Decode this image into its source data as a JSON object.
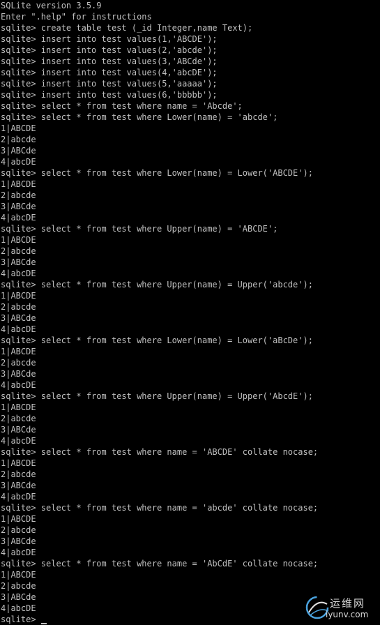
{
  "terminal": {
    "lines": [
      "SQLite version 3.5.9",
      "Enter \".help\" for instructions",
      "sqlite> create table test (_id Integer,name Text);",
      "sqlite> insert into test values(1,'ABCDE');",
      "sqlite> insert into test values(2,'abcde');",
      "sqlite> insert into test values(3,'ABCde');",
      "sqlite> insert into test values(4,'abcDE');",
      "sqlite> insert into test values(5,'aaaaa');",
      "sqlite> insert into test values(6,'bbbbb');",
      "sqlite> select * from test where name = 'Abcde';",
      "sqlite> select * from test where Lower(name) = 'abcde';",
      "1|ABCDE",
      "2|abcde",
      "3|ABCde",
      "4|abcDE",
      "sqlite> select * from test where Lower(name) = Lower('ABCDE');",
      "1|ABCDE",
      "2|abcde",
      "3|ABCde",
      "4|abcDE",
      "sqlite> select * from test where Upper(name) = 'ABCDE';",
      "1|ABCDE",
      "2|abcde",
      "3|ABCde",
      "4|abcDE",
      "sqlite> select * from test where Upper(name) = Upper('abcde');",
      "1|ABCDE",
      "2|abcde",
      "3|ABCde",
      "4|abcDE",
      "sqlite> select * from test where Lower(name) = Lower('aBcDe');",
      "1|ABCDE",
      "2|abcde",
      "3|ABCde",
      "4|abcDE",
      "sqlite> select * from test where Upper(name) = Upper('AbcdE');",
      "1|ABCDE",
      "2|abcde",
      "3|ABCde",
      "4|abcDE",
      "sqlite> select * from test where name = 'ABCDE' collate nocase;",
      "1|ABCDE",
      "2|abcde",
      "3|ABCde",
      "4|abcDE",
      "sqlite> select * from test where name = 'abcde' collate nocase;",
      "1|ABCDE",
      "2|abcde",
      "3|ABCde",
      "4|abcDE",
      "sqlite> select * from test where name = 'AbCdE' collate nocase;",
      "1|ABCDE",
      "2|abcde",
      "3|ABCde",
      "4|abcDE"
    ],
    "prompt": "sqlite> "
  },
  "watermark": {
    "name_cn": "运维网",
    "domain": "iyunv.com"
  },
  "colors": {
    "background": "#000000",
    "text": "#c0c0c0",
    "watermark": "#d8d8d8",
    "watermark_accent": "#4aa3df"
  },
  "icons": {
    "watermark_logo": "globe-swirl-icon",
    "cursor": "block-cursor-icon"
  }
}
